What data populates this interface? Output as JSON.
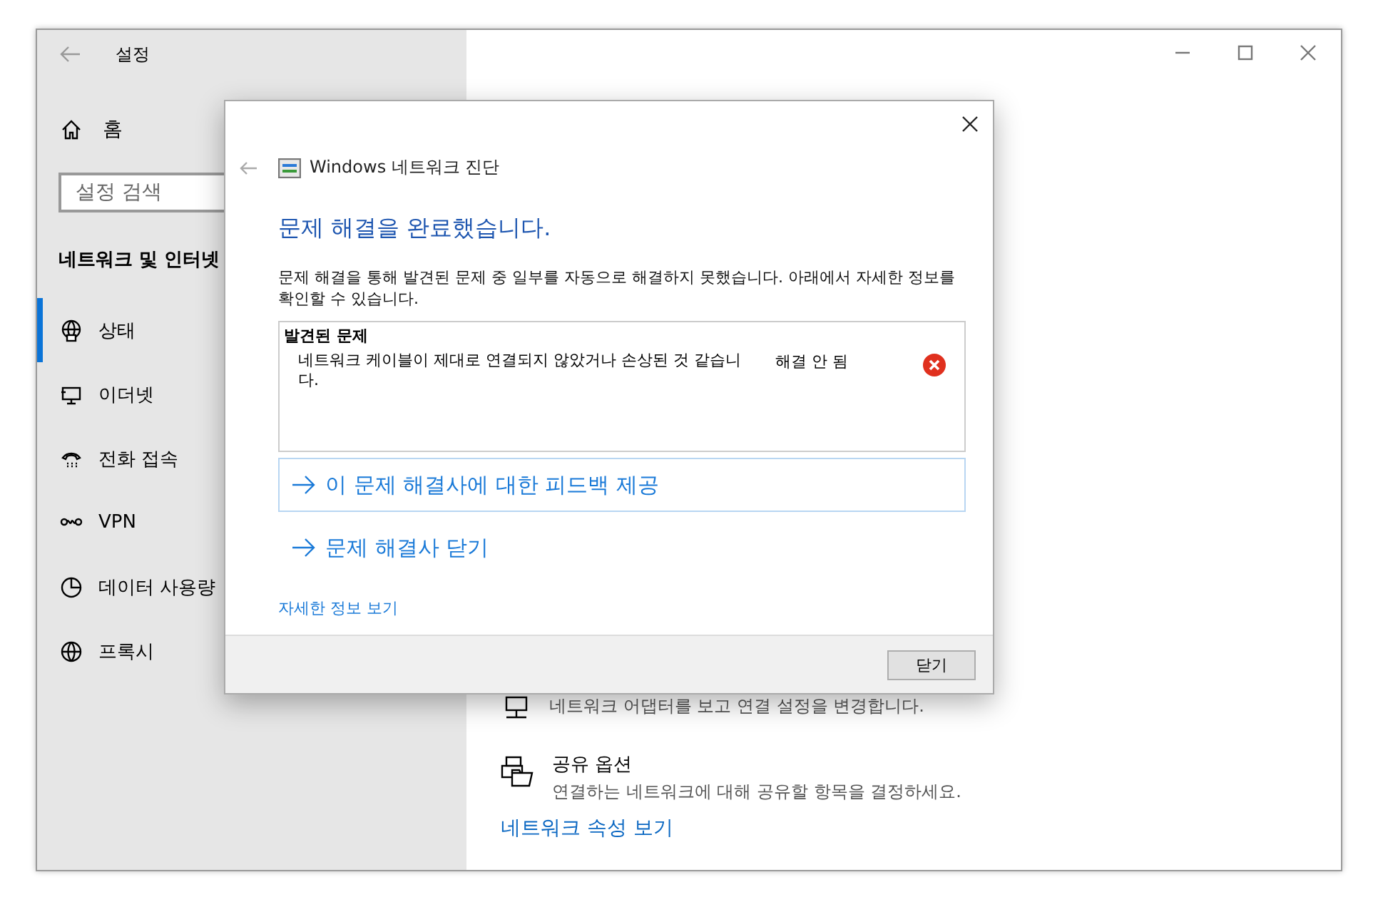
{
  "window": {
    "title": "설정"
  },
  "sidebar": {
    "home": "홈",
    "search": {
      "placeholder": "설정 검색"
    },
    "section": "네트워크 및 인터넷",
    "items": [
      {
        "label": "상태",
        "selected": true
      },
      {
        "label": "이더넷",
        "selected": false
      },
      {
        "label": "전화 접속",
        "selected": false
      },
      {
        "label": "VPN",
        "selected": false
      },
      {
        "label": "데이터 사용량",
        "selected": false
      },
      {
        "label": "프록시",
        "selected": false
      }
    ]
  },
  "content": {
    "adapter_description": "네트워크 어댑터를 보고 연결 설정을 변경합니다.",
    "sharing": {
      "title": "공유 옵션",
      "description": "연결하는 네트워크에 대해 공유할 항목을 결정하세요."
    },
    "link": "네트워크 속성 보기"
  },
  "dialog": {
    "title": "Windows 네트워크 진단",
    "heading": "문제 해결을 완료했습니다.",
    "message": "문제 해결을 통해 발견된 문제 중 일부를 자동으로 해결하지 못했습니다. 아래에서 자세한 정보를 확인할 수 있습니다.",
    "problems": {
      "header": "발견된 문제",
      "rows": [
        {
          "text": "네트워크 케이블이 제대로 연결되지 않았거나 손상된 것 같습니다.",
          "status": "해결 안 됨",
          "resolved": false
        }
      ]
    },
    "actions": [
      {
        "label": "이 문제 해결사에 대한 피드백 제공",
        "boxed": true
      },
      {
        "label": "문제 해결사 닫기",
        "boxed": false
      }
    ],
    "details_link": "자세한 정보 보기",
    "close_button": "닫기"
  }
}
